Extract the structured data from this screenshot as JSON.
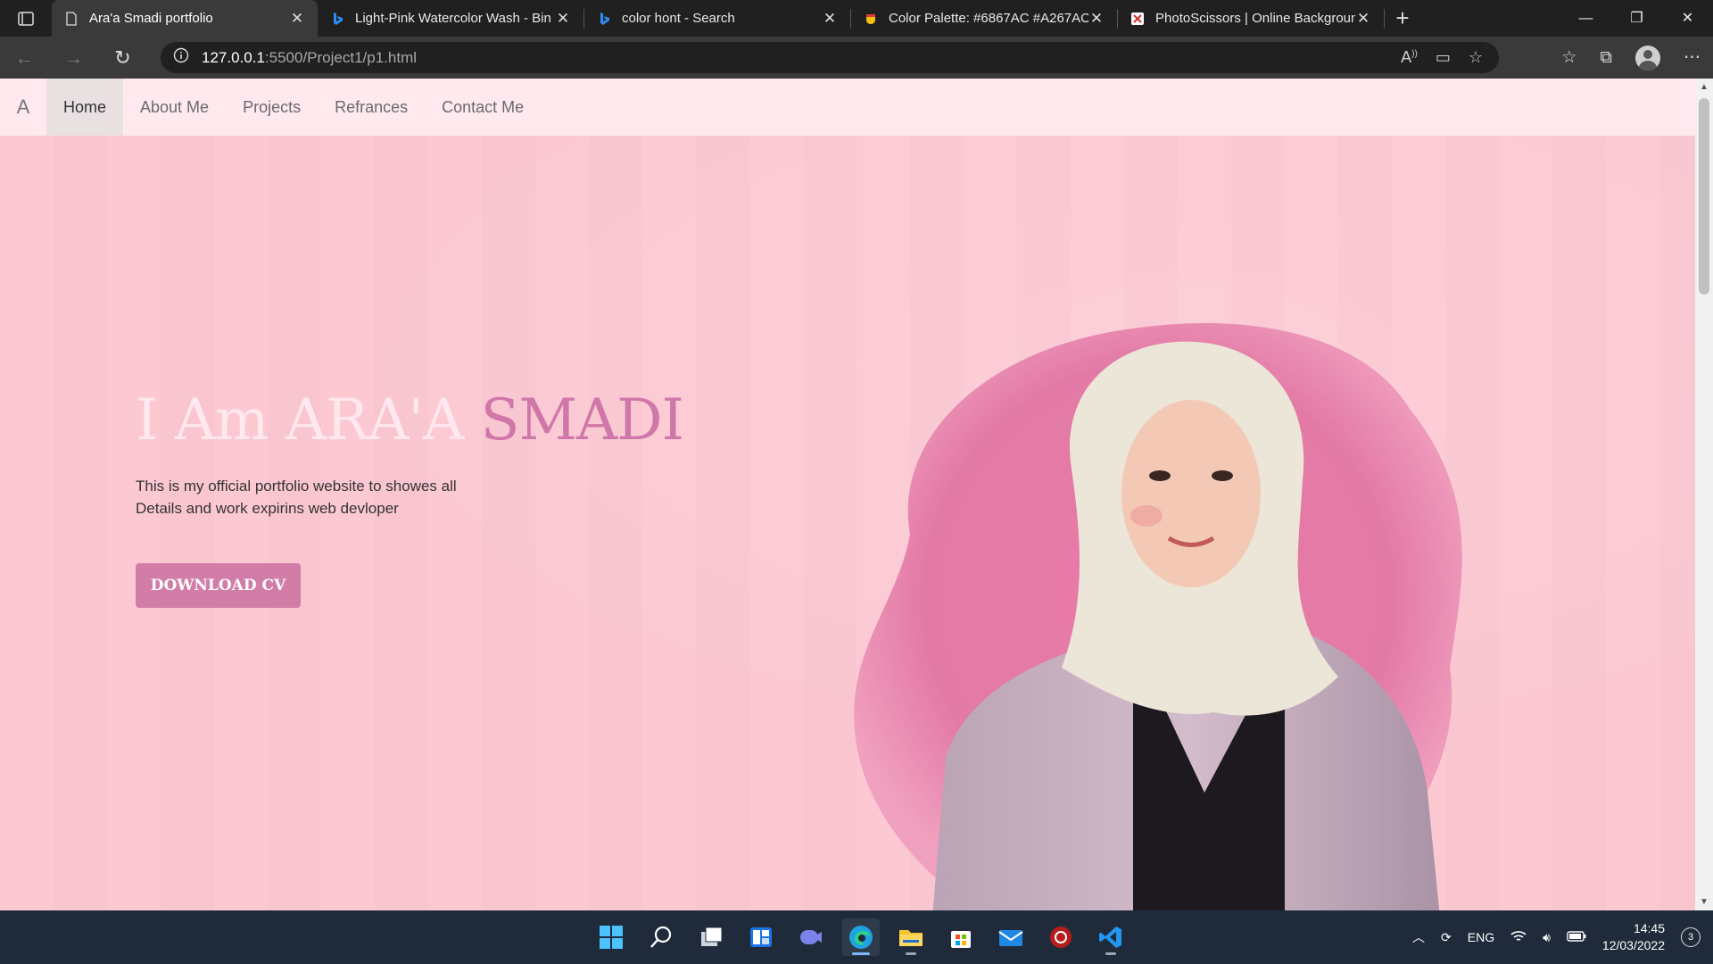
{
  "browser": {
    "tabs": [
      {
        "title": "Ara'a Smadi portfolio",
        "active": true,
        "favicon": "page-icon"
      },
      {
        "title": "Light-Pink Watercolor Wash - Bin",
        "active": false,
        "favicon": "bing-icon"
      },
      {
        "title": "color hont - Search",
        "active": false,
        "favicon": "bing-icon"
      },
      {
        "title": "Color Palette: #6867AC #A267AC",
        "active": false,
        "favicon": "palette-icon"
      },
      {
        "title": "PhotoScissors | Online Backgroun",
        "active": false,
        "favicon": "photoscissors-icon"
      }
    ],
    "url_host": "127.0.0.1",
    "url_path": ":5500/Project1/p1.html"
  },
  "site": {
    "brand": "A",
    "nav": [
      {
        "label": "Home",
        "active": true
      },
      {
        "label": "About Me",
        "active": false
      },
      {
        "label": "Projects",
        "active": false
      },
      {
        "label": "Refrances",
        "active": false
      },
      {
        "label": "Contact Me",
        "active": false
      }
    ],
    "hero": {
      "title_prefix": "I Am ARA'A",
      "title_accent": "SMADI",
      "text_line1": "This is my official portfolio website to showes all",
      "text_line2": "Details and work expirins web devloper",
      "button": "DOWNLOAD CV"
    },
    "colors": {
      "nav_bg": "#ffe9ee",
      "hero_bg": "#fcc7d1",
      "accent": "#d077a9",
      "button": "#d27ca8"
    }
  },
  "taskbar": {
    "lang": "ENG",
    "time": "14:45",
    "date": "12/03/2022",
    "notifications": "3"
  }
}
